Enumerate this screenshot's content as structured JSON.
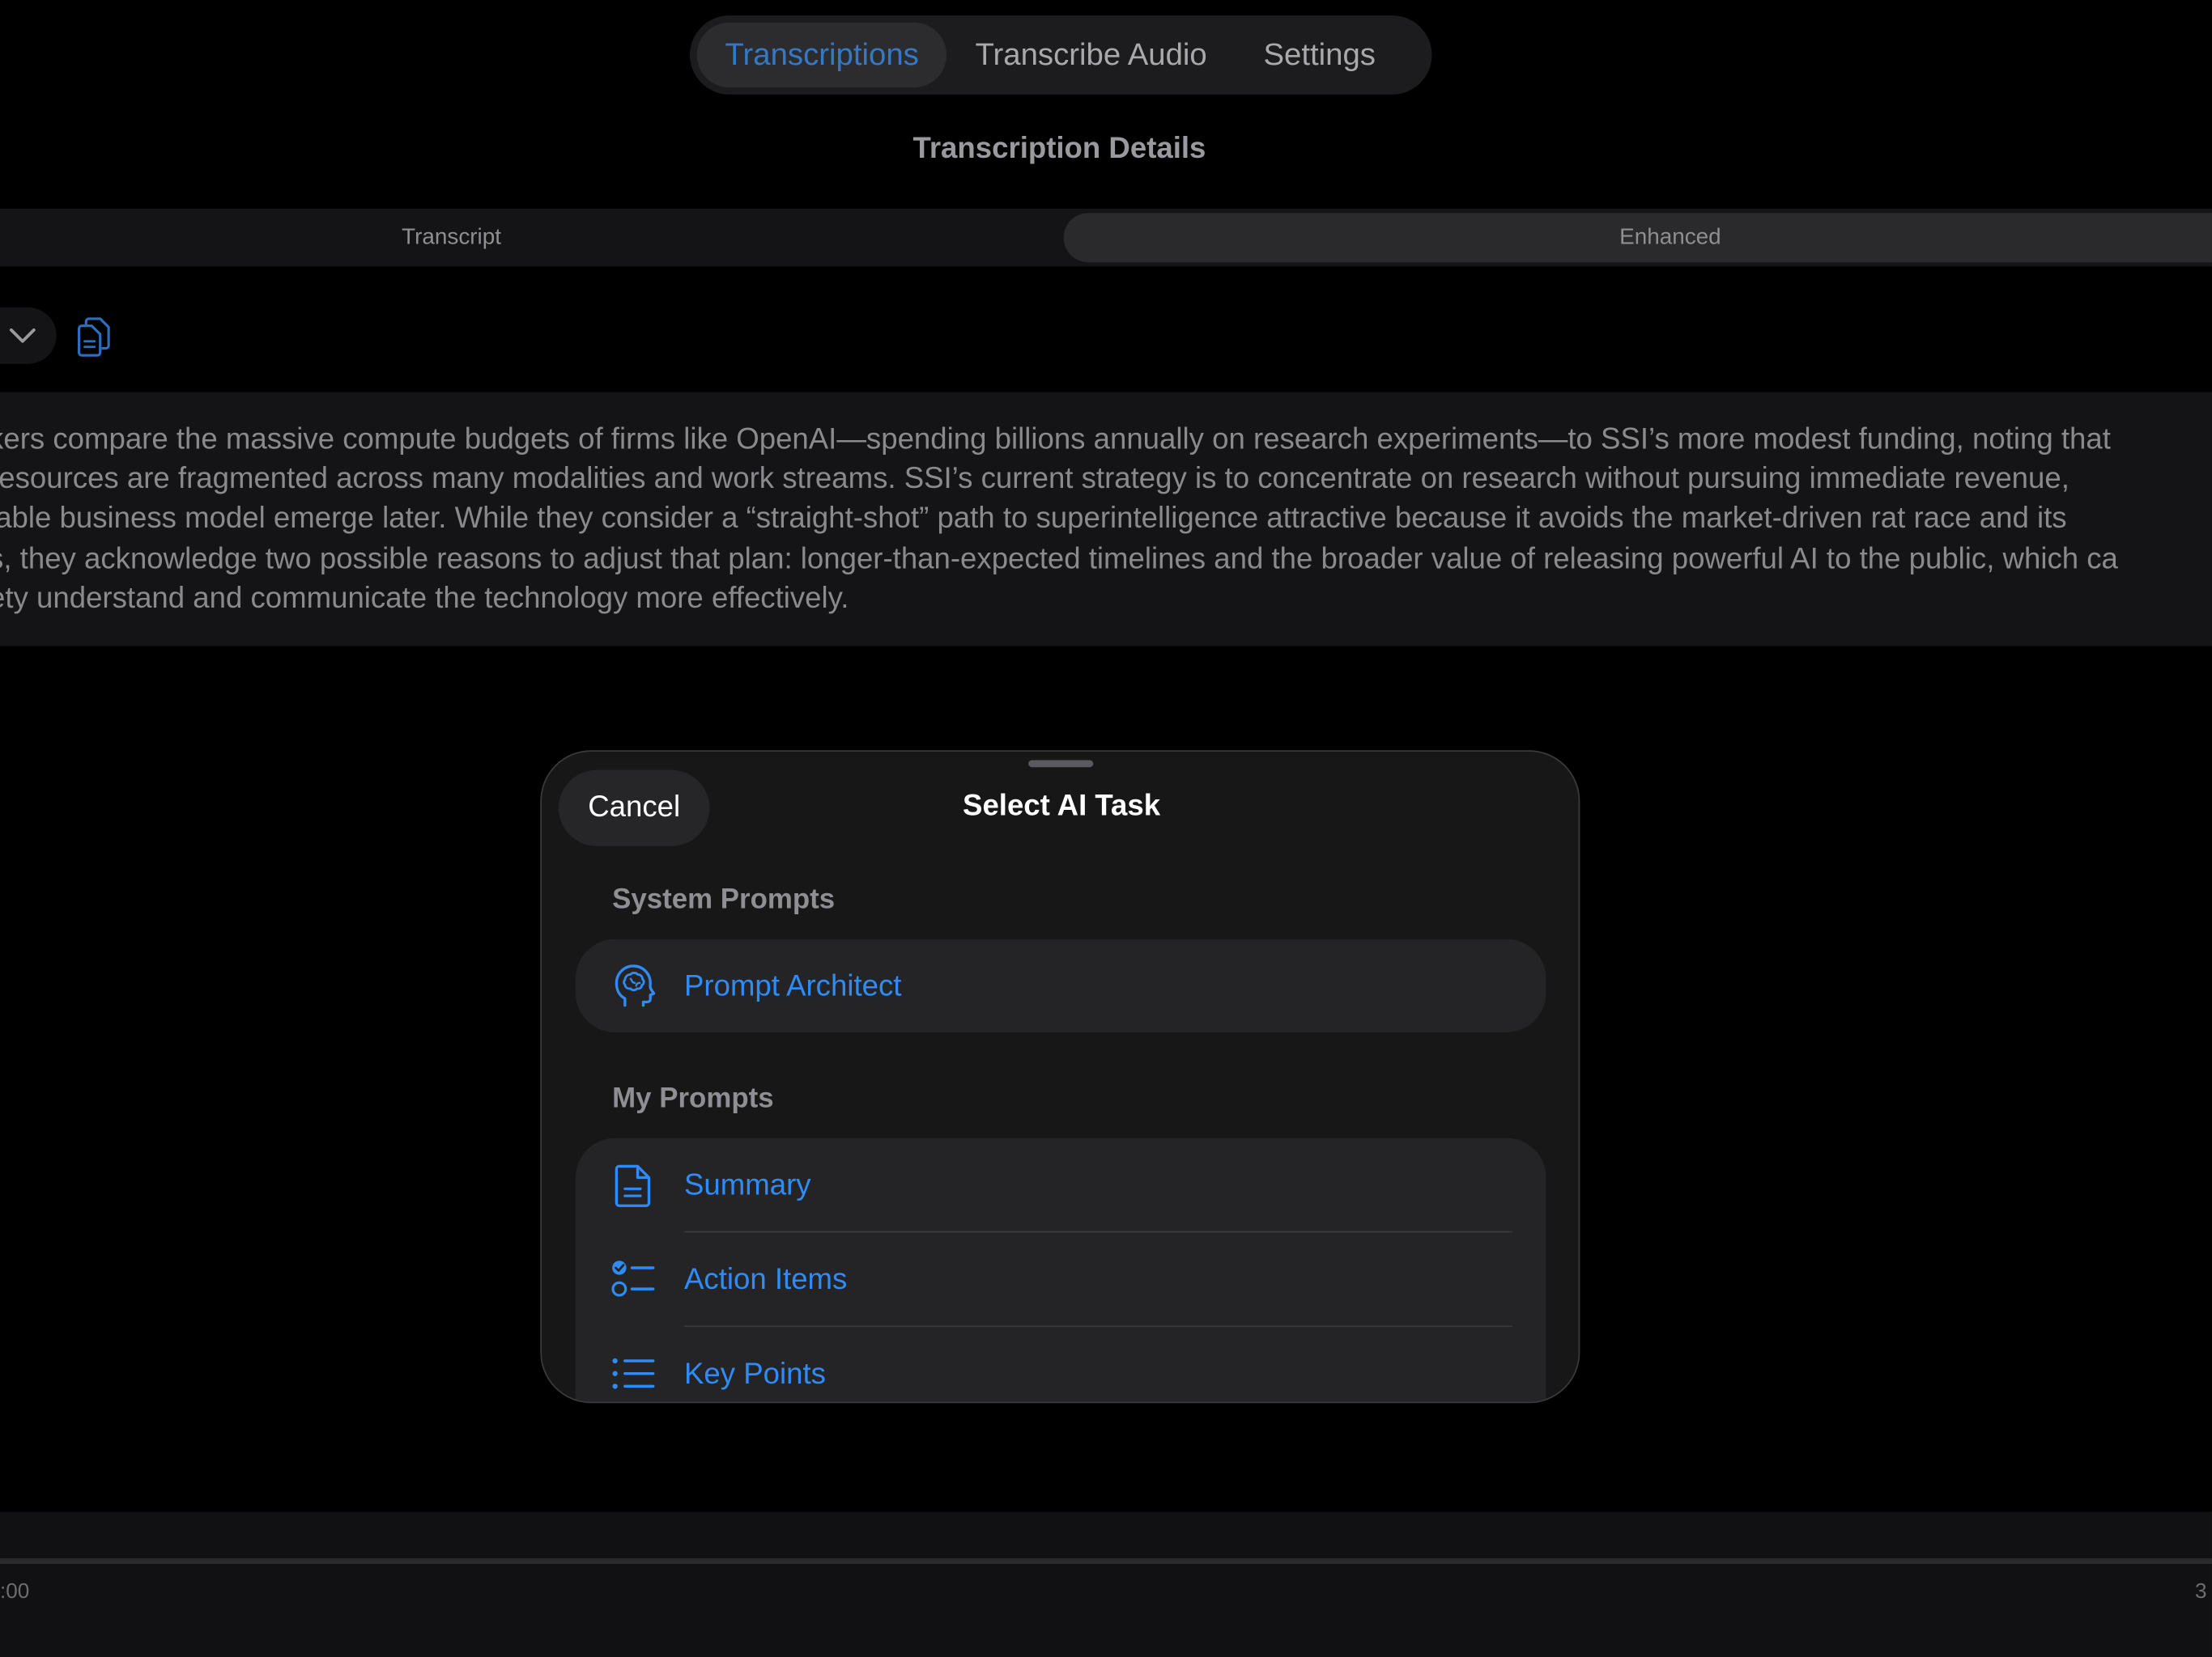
{
  "top_tabs": [
    "Transcriptions",
    "Transcribe Audio",
    "Settings"
  ],
  "active_top_tab": "Transcriptions",
  "details_title": "Transcription Details",
  "sub_tabs": {
    "transcript": "Transcript",
    "enhanced": "Enhanced"
  },
  "text_lines": [
    "kers compare the massive compute budgets of firms like OpenAI—spending billions annually on research experiments—to SSI’s more modest funding, noting that",
    "resources are fragmented across many modalities and work streams. SSI’s current strategy is to concentrate on research without pursuing immediate revenue,",
    "iable business model emerge later. While they consider a “straight-shot” path to superintelligence attractive because it avoids the market-driven rat race and its",
    "s, they acknowledge two possible reasons to adjust that plan: longer-than-expected timelines and the broader value of releasing powerful AI to the public, which ca",
    "ety understand and communicate the technology more effectively."
  ],
  "player": {
    "time_start": ":00",
    "time_end": "3"
  },
  "sheet": {
    "cancel_label": "Cancel",
    "title": "Select AI Task",
    "system_header": "System Prompts",
    "system_items": [
      {
        "label": "Prompt Architect",
        "icon": "brain-head-icon"
      }
    ],
    "my_header": "My Prompts",
    "my_items": [
      {
        "label": "Summary",
        "icon": "document-icon"
      },
      {
        "label": "Action Items",
        "icon": "checklist-icon"
      },
      {
        "label": "Key Points",
        "icon": "bullet-list-icon"
      }
    ]
  },
  "colors": {
    "accent": "#2f8cf6",
    "background": "#000000",
    "sheet": "#171718",
    "row": "#242426"
  }
}
